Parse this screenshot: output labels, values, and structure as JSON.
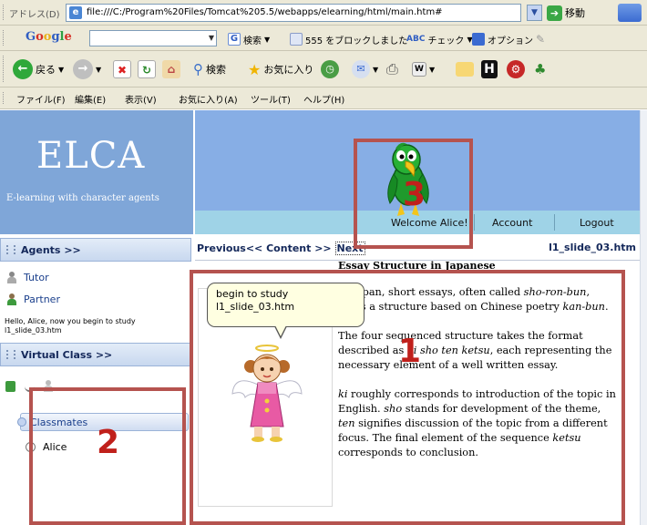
{
  "browser": {
    "address_label": "アドレス(D)",
    "url": "file:///C:/Program%20Files/Tomcat%205.5/webapps/elearning/html/main.htm#",
    "go_label": "移動"
  },
  "google_toolbar": {
    "logo": [
      "G",
      "o",
      "o",
      "g",
      "l",
      "e"
    ],
    "search_label": "検索",
    "blocked_label": "555 をブロックしました",
    "check_label": "チェック",
    "options_label": "オプション"
  },
  "nav_toolbar": {
    "back_label": "戻る",
    "search_label": "検索",
    "favorites_label": "お気に入り"
  },
  "menu_bar": {
    "file": "ファイル(F)",
    "edit": "編集(E)",
    "view": "表示(V)",
    "favorites": "お気に入り(A)",
    "tools": "ツール(T)",
    "help": "ヘルプ(H)"
  },
  "header": {
    "title": "ELCA",
    "subtitle": "E-learning with character agents",
    "welcome": "Welcome Alice!",
    "account": "Account",
    "logout": "Logout"
  },
  "sidebar": {
    "agents_head": "Agents >>",
    "tutor": "Tutor",
    "partner": "Partner",
    "hello_msg": "Hello, Alice, now you begin to study l1_slide_03.htm",
    "virtual_class_head": "Virtual Class >>",
    "classmates": "Classmates",
    "alice": "Alice"
  },
  "content_nav": {
    "previous": "Previous<<",
    "content": "Content >>",
    "next": "Next",
    "slide_name": "l1_slide_03.htm"
  },
  "agent": {
    "bubble_line1": "begin to study",
    "bubble_line2": "l1_slide_03.htm"
  },
  "article": {
    "title": "Essay Structure in Japanese",
    "p1_a": "In Japan, short essays, often called ",
    "p1_b": "sho-ron-bun",
    "p1_c": ", takes a structure based on Chinese poetry ",
    "p1_d": "kan-bun",
    "p1_e": ".",
    "p2_a": "The four sequenced structure takes the format described as ",
    "p2_b": "ki sho ten ketsu",
    "p2_c": ", each representing the necessary element of a well written essay.",
    "p3_a": "ki",
    "p3_b": " roughly corresponds to introduction of the topic in English. ",
    "p3_c": "sho",
    "p3_d": " stands for development of the theme, ",
    "p3_e": "ten",
    "p3_f": " signifies discussion of the topic from a different focus. The final element of the sequence ",
    "p3_g": "ketsu",
    "p3_h": " corresponds to conclusion."
  },
  "annotations": {
    "label_1": "1",
    "label_2": "2",
    "label_3": "3",
    "color": "#b5534f"
  },
  "colors": {
    "header_blue": "#87aee5",
    "nav_teal": "#9fd3e7",
    "link_blue": "#1a3f8c"
  }
}
